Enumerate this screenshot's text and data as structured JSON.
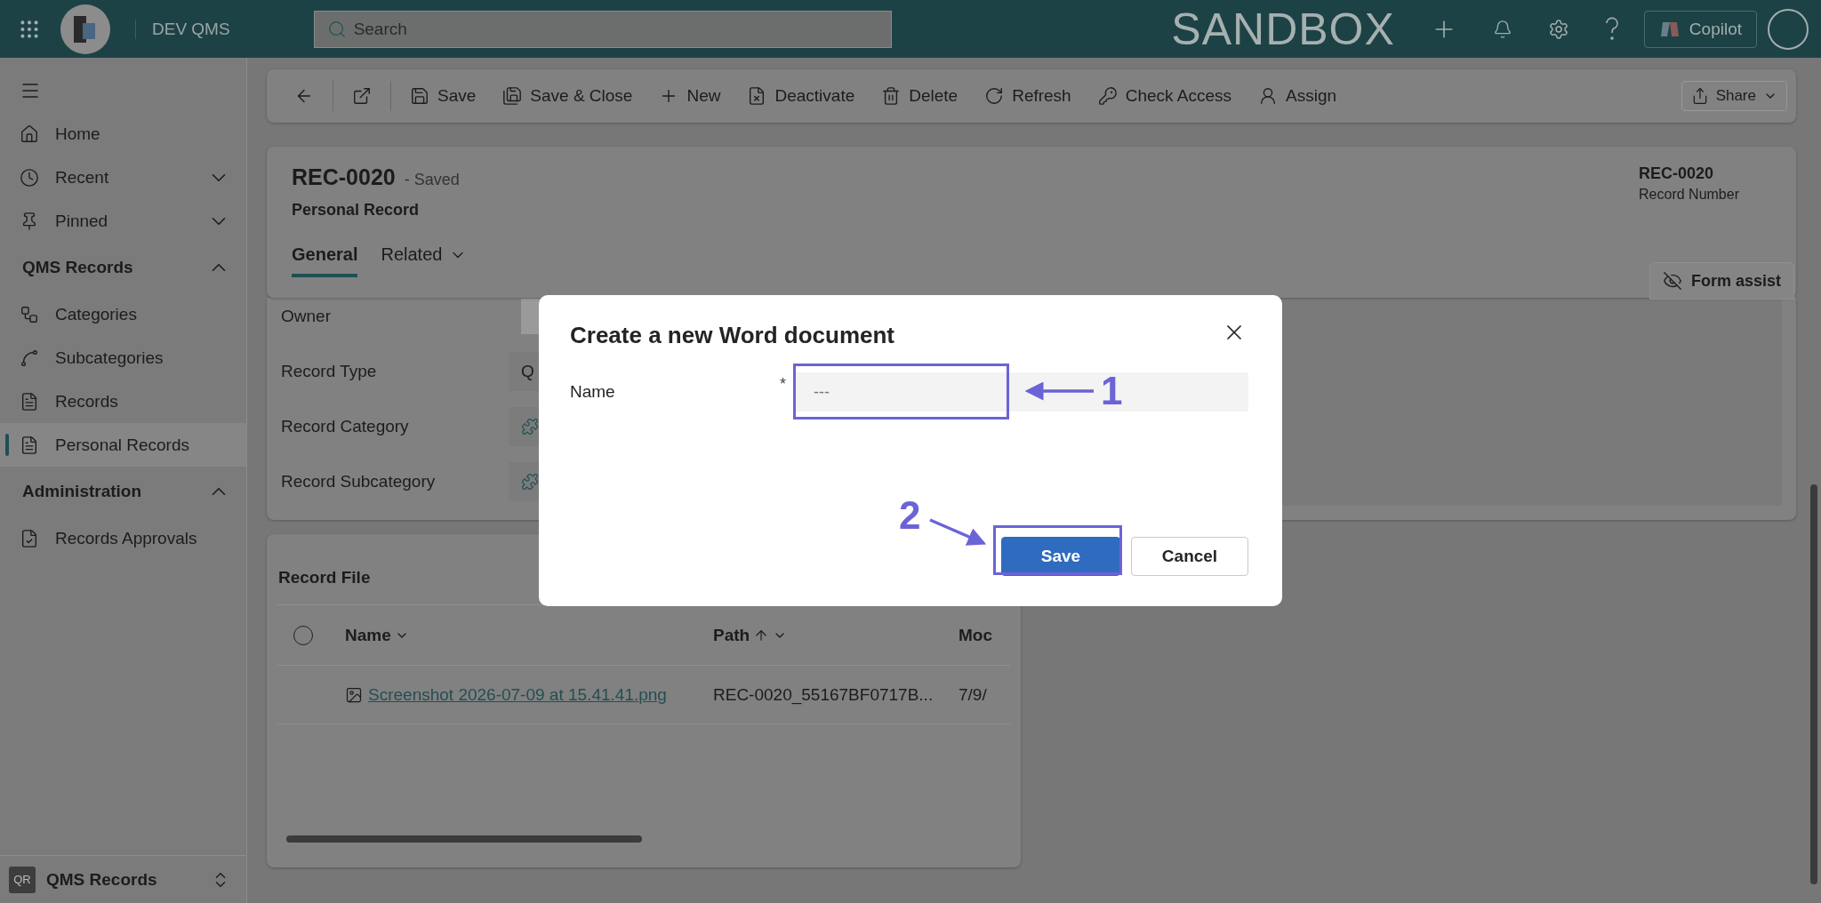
{
  "top_bar": {
    "app_name": "DEV QMS",
    "search": {
      "placeholder": "Search"
    },
    "environment": "SANDBOX",
    "copilot": "Copilot"
  },
  "sidebar": {
    "nav": [
      {
        "label": "Home"
      },
      {
        "label": "Recent",
        "expanded": false
      },
      {
        "label": "Pinned",
        "expanded": false
      }
    ],
    "groups": [
      {
        "label": "QMS Records",
        "expanded": true,
        "items": [
          {
            "label": "Categories",
            "selected": false
          },
          {
            "label": "Subcategories",
            "selected": false
          },
          {
            "label": "Records",
            "selected": false
          },
          {
            "label": "Personal Records",
            "selected": true
          }
        ]
      },
      {
        "label": "Administration",
        "expanded": true,
        "items": [
          {
            "label": "Records Approvals",
            "selected": false
          }
        ]
      }
    ],
    "area_switcher": {
      "badge": "QR",
      "label": "QMS Records"
    }
  },
  "command_bar": {
    "commands": [
      "Save",
      "Save & Close",
      "New",
      "Deactivate",
      "Delete",
      "Refresh",
      "Check Access",
      "Assign"
    ],
    "share": "Share"
  },
  "record": {
    "number": "REC-0020",
    "status": "- Saved",
    "entity": "Personal Record",
    "header_fields": [
      {
        "value": "REC-0020",
        "label": "Record Number"
      }
    ],
    "tabs": [
      {
        "label": "General",
        "selected": true
      },
      {
        "label": "Related",
        "selected": false
      }
    ],
    "form_assist": "Form assist",
    "fields": [
      {
        "label": "Owner",
        "kind": "avatar"
      },
      {
        "label": "Record Type",
        "kind": "text",
        "value": "Q"
      },
      {
        "label": "Record Category",
        "kind": "lookup"
      },
      {
        "label": "Record Subcategory",
        "kind": "lookup"
      }
    ]
  },
  "record_file": {
    "title": "Record File",
    "select_all": {
      "checked": false
    },
    "columns": [
      {
        "label": "Name",
        "menu": true,
        "sorted": false
      },
      {
        "label": "Path",
        "menu": true,
        "sorted": true
      },
      {
        "label": "Moc",
        "menu": false,
        "sorted": false
      }
    ],
    "rows": [
      {
        "cells": [
          "Screenshot 2026-07-09 at 15.41.41.png",
          "REC-0020_55167BF0717B...",
          "7/9/"
        ]
      }
    ]
  },
  "dialog": {
    "title": "Create a new Word document",
    "fields": [
      {
        "label": "Name",
        "required_mark": "*",
        "placeholder": "---"
      }
    ],
    "buttons": [
      {
        "label": "Save",
        "kind": "primary"
      },
      {
        "label": "Cancel",
        "kind": "secondary"
      }
    ],
    "annotations": [
      {
        "label": "1"
      },
      {
        "label": "2"
      }
    ]
  }
}
